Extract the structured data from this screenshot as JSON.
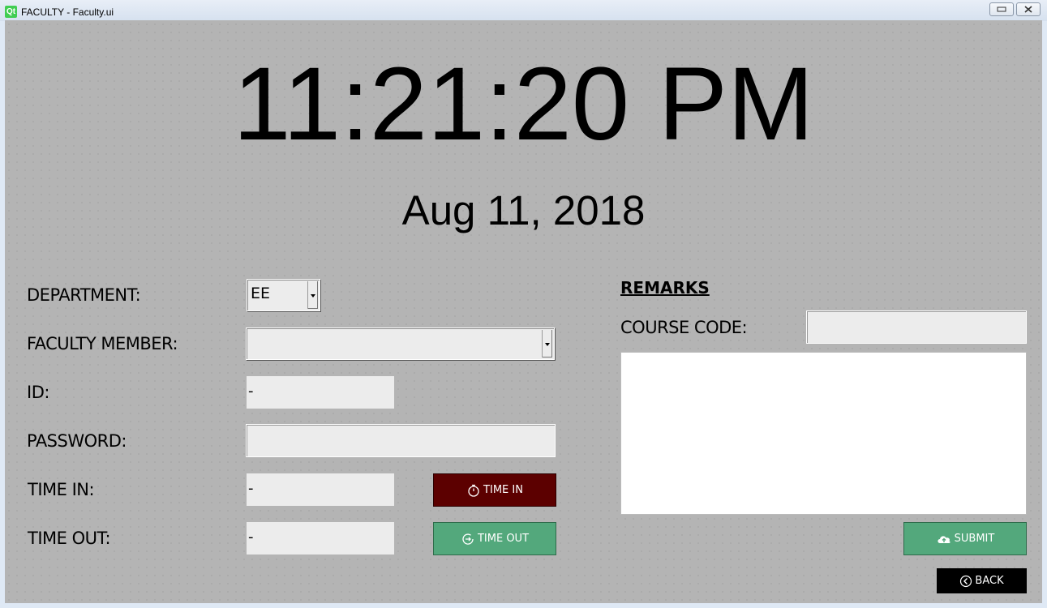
{
  "window": {
    "app_icon": "qt-logo-icon",
    "app_icon_text": "Qt",
    "title": "FACULTY - Faculty.ui"
  },
  "clock": {
    "time": "11:21:20 PM",
    "date": "Aug 11, 2018"
  },
  "form": {
    "department_label": "DEPARTMENT:",
    "department_value": "EE",
    "faculty_label": "FACULTY MEMBER:",
    "faculty_value": "",
    "id_label": "ID:",
    "id_value": "-",
    "password_label": "PASSWORD:",
    "password_value": "",
    "time_in_label": "TIME IN:",
    "time_in_value": "-",
    "time_out_label": "TIME OUT:",
    "time_out_value": "-"
  },
  "buttons": {
    "time_in": "TIME IN",
    "time_out": "TIME OUT",
    "submit": "SUBMIT",
    "back": "BACK"
  },
  "remarks": {
    "title": "REMARKS",
    "course_code_label": "COURSE CODE:",
    "course_code_value": "",
    "text": ""
  },
  "colors": {
    "background": "#b4b4b4",
    "time_in_button": "#5c0000",
    "time_out_button": "#53a87c",
    "submit_button": "#53a87c",
    "back_button": "#000000"
  },
  "icons": {
    "time_in": "stopwatch-icon",
    "time_out": "clock-arrow-icon",
    "submit": "cloud-upload-icon",
    "back": "circle-chevron-left-icon"
  }
}
